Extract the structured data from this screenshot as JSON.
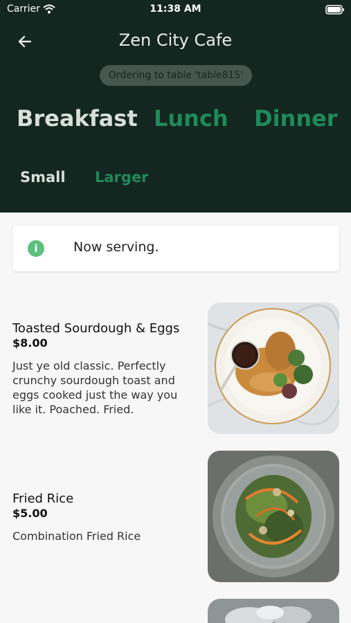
{
  "status_bar": {
    "carrier": "Carrier",
    "time": "11:38 AM"
  },
  "header": {
    "title": "Zen City Cafe",
    "table_badge": "Ordering to table 'table815'",
    "meal_tabs": [
      "Breakfast",
      "Lunch",
      "Dinner"
    ],
    "size_tabs": [
      "Small",
      "Larger"
    ]
  },
  "notice": {
    "text": "Now serving."
  },
  "menu_items": [
    {
      "title": "Toasted Sourdough & Eggs",
      "price": "$8.00",
      "description": "Just ye old classic. Perfectly crunchy sourdough toast and eggs cooked just the way you like it. Poached. Fried."
    },
    {
      "title": "Fried Rice",
      "price": "$5.00",
      "description": "Combination Fried Rice"
    }
  ],
  "colors": {
    "header_bg": "#13261f",
    "accent_green": "#1f8a5a",
    "info_green": "#5cc07f"
  }
}
